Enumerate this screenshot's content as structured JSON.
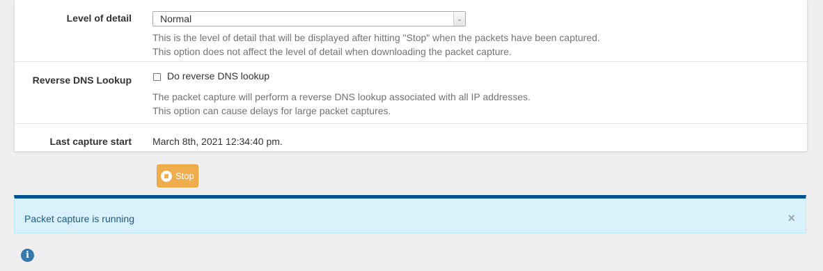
{
  "form": {
    "level_of_detail": {
      "label": "Level of detail",
      "selected": "Normal",
      "help_line1": "This is the level of detail that will be displayed after hitting \"Stop\" when the packets have been captured.",
      "help_line2": "This option does not affect the level of detail when downloading the packet capture."
    },
    "reverse_dns": {
      "label": "Reverse DNS Lookup",
      "checkbox_label": "Do reverse DNS lookup",
      "checked": false,
      "help_line1": "The packet capture will perform a reverse DNS lookup associated with all IP addresses.",
      "help_line2": "This option can cause delays for large packet captures."
    },
    "last_capture": {
      "label": "Last capture start",
      "value": "March 8th, 2021 12:34:40 pm."
    }
  },
  "actions": {
    "stop_label": "Stop"
  },
  "alert": {
    "message": "Packet capture is running",
    "close_glyph": "×"
  },
  "icons": {
    "info": "i",
    "select_arrow": "⌄"
  },
  "colors": {
    "stop_button": "#f0ad4e",
    "alert_bg": "#d9f1fb",
    "alert_border_top": "#00528d",
    "info_icon": "#3778ac"
  }
}
